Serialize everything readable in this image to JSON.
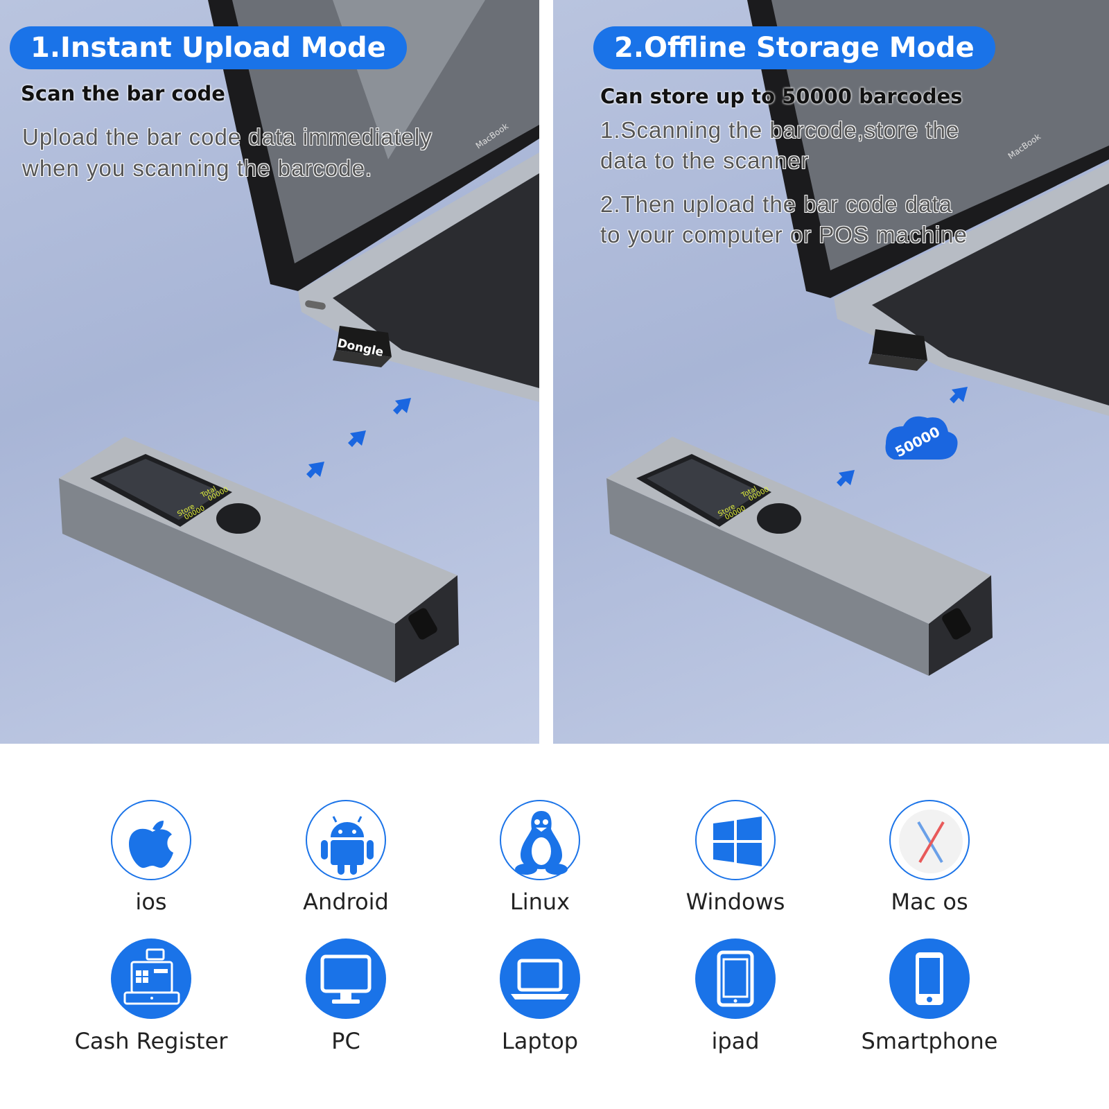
{
  "mode1": {
    "title": "1.Instant Upload Mode",
    "subtitle": "Scan the bar code",
    "desc_line1": "Upload the bar code data immediately",
    "desc_line2": "when you scanning the barcode.",
    "dongle_label": "Dongle"
  },
  "mode2": {
    "title": "2.Offline Storage Mode",
    "subtitle": "Can store up to 50000 barcodes",
    "step1_line1": "1.Scanning the barcode,store the",
    "step1_line2": "data to the scanner",
    "step2_line1": "2.Then upload the bar code data",
    "step2_line2": "to your computer or POS machine",
    "cloud_label": "50000"
  },
  "scanner_screen": {
    "store_label": "Store",
    "store_value": "00000",
    "total_label": "Total",
    "total_value": "00000"
  },
  "laptop_brand": "MacBook",
  "compatibility": [
    {
      "label": "ios",
      "icon": "apple-icon",
      "style": "outline"
    },
    {
      "label": "Android",
      "icon": "android-icon",
      "style": "outline"
    },
    {
      "label": "Linux",
      "icon": "linux-penguin-icon",
      "style": "outline"
    },
    {
      "label": "Windows",
      "icon": "windows-icon",
      "style": "outline"
    },
    {
      "label": "Mac os",
      "icon": "macos-x-icon",
      "style": "outline"
    },
    {
      "label": "Cash Register",
      "icon": "cash-register-icon",
      "style": "filled"
    },
    {
      "label": "PC",
      "icon": "monitor-icon",
      "style": "filled"
    },
    {
      "label": "Laptop",
      "icon": "laptop-icon",
      "style": "filled"
    },
    {
      "label": "ipad",
      "icon": "tablet-icon",
      "style": "filled"
    },
    {
      "label": "Smartphone",
      "icon": "smartphone-icon",
      "style": "filled"
    }
  ],
  "colors": {
    "accent": "#1a73e8",
    "background": "#a8b5d6",
    "scanner_body": "#8e949c",
    "screen_text": "#e6f53a"
  }
}
